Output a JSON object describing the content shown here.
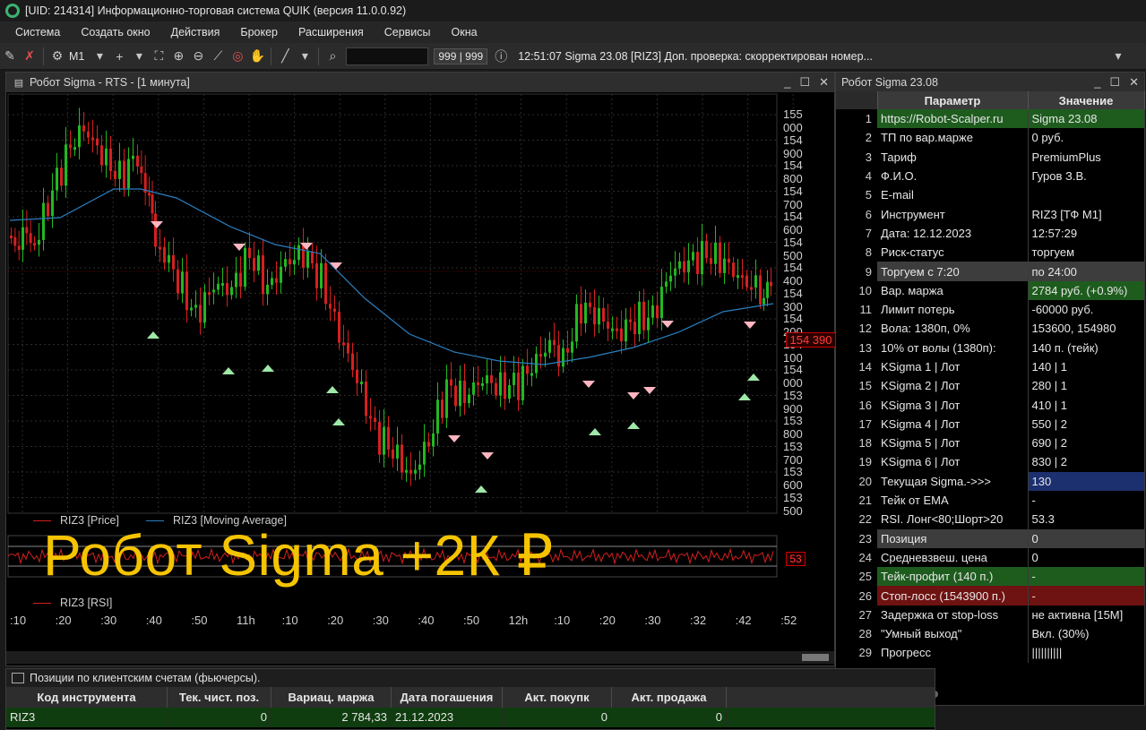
{
  "app": {
    "title": "[UID: 214314] Информационно-торговая система QUIK (версия 11.0.0.92)"
  },
  "menu": [
    "Система",
    "Создать окно",
    "Действия",
    "Брокер",
    "Расширения",
    "Сервисы",
    "Окна"
  ],
  "toolbar": {
    "interval": "M1",
    "counter": "999 | 999",
    "message": "12:51:07  Sigma 23.08 [RIZ3] Доп. проверка: скорректирован номер..."
  },
  "chart": {
    "window_title": "Робот Sigma - RTS   - [1 минута]",
    "price_ticks": [
      "155 000",
      "154 900",
      "154 800",
      "154 700",
      "154 600",
      "154 500",
      "154 400",
      "154 300",
      "154 200",
      "154 100",
      "154 000",
      "153 900",
      "153 800",
      "153 700",
      "153 600",
      "153 500"
    ],
    "current_price": "154 390",
    "legend_price": "RIZ3 [Price]",
    "legend_ma": "RIZ3 [Moving Average]",
    "legend_rsi": "RIZ3 [RSI]",
    "rsi_value": "53",
    "time_ticks": [
      ":10",
      ":20",
      ":30",
      ":40",
      ":50",
      "11h",
      ":10",
      ":20",
      ":30",
      ":40",
      ":50",
      "12h",
      ":10",
      ":20",
      ":30",
      ":32",
      ":42",
      ":52"
    ],
    "colors": {
      "up": "#22b822",
      "down": "#d42020",
      "ma": "#2a7fc0",
      "rsi": "#d42020",
      "buy_marker": "#9fe8a8",
      "sell_marker": "#ffb6c1"
    }
  },
  "overlay": {
    "text": "Робот Sigma +2К ₽"
  },
  "params": {
    "window_title": "Робот Sigma 23.08",
    "col_param": "Параметр",
    "col_value": "Значение",
    "rows": [
      {
        "n": "1",
        "p": "https://Robot-Scalper.ru",
        "v": "Sigma 23.08",
        "hl": "green",
        "vhl": "green"
      },
      {
        "n": "2",
        "p": "ТП по вар.марже",
        "v": "0 руб."
      },
      {
        "n": "3",
        "p": "Тариф",
        "v": "PremiumPlus"
      },
      {
        "n": "4",
        "p": "Ф.И.О.",
        "v": "Гуров З.В."
      },
      {
        "n": "5",
        "p": "E-mail",
        "v": ""
      },
      {
        "n": "6",
        "p": "Инструмент",
        "v": "RIZ3 [ТФ М1]"
      },
      {
        "n": "7",
        "p": "Дата: 12.12.2023",
        "v": "12:57:29"
      },
      {
        "n": "8",
        "p": "Риск-статус",
        "v": "торгуем"
      },
      {
        "n": "9",
        "p": "Торгуем с 7:20",
        "v": "по 24:00",
        "hl": "gray",
        "vhl": "gray"
      },
      {
        "n": "10",
        "p": "Вар. маржа",
        "v": "2784 руб. (+0.9%)",
        "vhl": "green"
      },
      {
        "n": "11",
        "p": "Лимит потерь",
        "v": "-60000 руб."
      },
      {
        "n": "12",
        "p": "Вола: 1380п, 0%",
        "v": "153600, 154980"
      },
      {
        "n": "13",
        "p": "10% от волы (1380п):",
        "v": "140 п. (тейк)"
      },
      {
        "n": "14",
        "p": "KSigma 1 | Лот",
        "v": "140 | 1"
      },
      {
        "n": "15",
        "p": "KSigma 2 | Лот",
        "v": "280 | 1"
      },
      {
        "n": "16",
        "p": "KSigma 3 | Лот",
        "v": "410 | 1"
      },
      {
        "n": "17",
        "p": "KSigma 4 | Лот",
        "v": "550 | 2"
      },
      {
        "n": "18",
        "p": "KSigma 5 | Лот",
        "v": "690 | 2"
      },
      {
        "n": "19",
        "p": "KSigma 6 | Лот",
        "v": "830 | 2"
      },
      {
        "n": "20",
        "p": "Текущая Sigma.->>>",
        "v": "130",
        "vhl": "blue"
      },
      {
        "n": "21",
        "p": "Тейк от EMA",
        "v": "-"
      },
      {
        "n": "22",
        "p": "RSI. Лонг<80;Шорт>20",
        "v": "53.3"
      },
      {
        "n": "23",
        "p": "Позиция",
        "v": "0",
        "hl": "gray",
        "vhl": "gray"
      },
      {
        "n": "24",
        "p": "Средневзвеш. цена",
        "v": "0"
      },
      {
        "n": "25",
        "p": "Тейк-профит (140 п.)",
        "v": "-",
        "hl": "green",
        "vhl": "green"
      },
      {
        "n": "26",
        "p": "Стоп-лосс (1543900 п.)",
        "v": "-",
        "hl": "red",
        "vhl": "red"
      },
      {
        "n": "27",
        "p": "Задержка от stop-loss",
        "v": "не активна [15М]"
      },
      {
        "n": "28",
        "p": "\"Умный выход\"",
        "v": "Вкл. (30%)"
      },
      {
        "n": "29",
        "p": "Прогресс",
        "v": "||||||||||"
      }
    ]
  },
  "positions": {
    "window_title": "Позиции по клиентским счетам (фьючерсы).",
    "columns": [
      "Код инструмента",
      "Тек. чист. поз.",
      "Вариац. маржа",
      "Дата погашения",
      "Акт. покупк",
      "Акт. продажа"
    ],
    "rows": [
      [
        "RIZ3",
        "0",
        "2 784,33",
        "21.12.2023",
        "0",
        "0"
      ]
    ]
  }
}
